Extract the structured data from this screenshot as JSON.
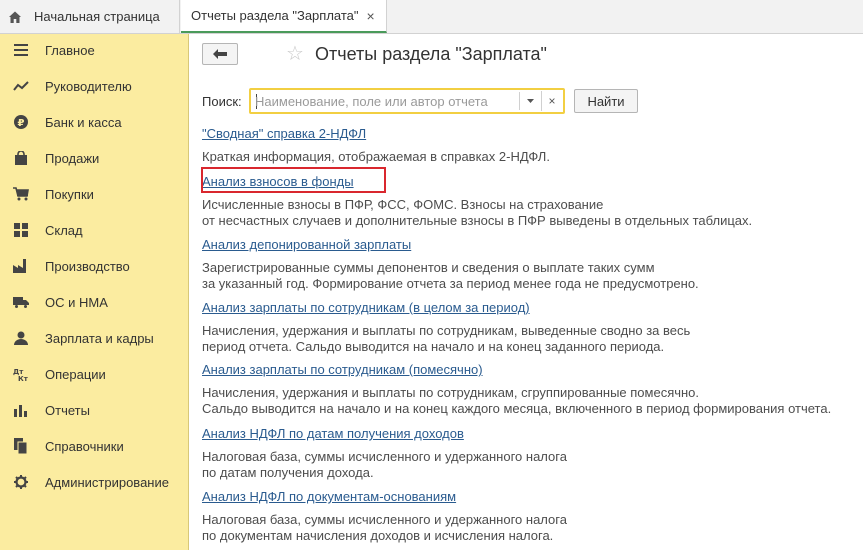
{
  "tabs": {
    "home_label": "Начальная страница",
    "active_label": "Отчеты раздела \"Зарплата\"",
    "close_glyph": "×"
  },
  "sidebar": {
    "background": "#fbeca0",
    "items": [
      {
        "label": "Главное",
        "icon": "menu-lines-icon"
      },
      {
        "label": "Руководителю",
        "icon": "trend-icon"
      },
      {
        "label": "Банк и касса",
        "icon": "ruble-icon"
      },
      {
        "label": "Продажи",
        "icon": "shopping-bag-icon"
      },
      {
        "label": "Покупки",
        "icon": "cart-icon"
      },
      {
        "label": "Склад",
        "icon": "grid-icon"
      },
      {
        "label": "Производство",
        "icon": "factory-icon"
      },
      {
        "label": "ОС и НМА",
        "icon": "truck-icon"
      },
      {
        "label": "Зарплата и кадры",
        "icon": "person-icon"
      },
      {
        "label": "Операции",
        "icon": "debit-credit-icon"
      },
      {
        "label": "Отчеты",
        "icon": "bar-chart-icon"
      },
      {
        "label": "Справочники",
        "icon": "books-icon"
      },
      {
        "label": "Администрирование",
        "icon": "gear-icon"
      }
    ]
  },
  "header": {
    "title": "Отчеты раздела \"Зарплата\""
  },
  "search": {
    "label": "Поиск:",
    "placeholder": "Наименование, поле или автор отчета",
    "button_label": "Найти"
  },
  "reports": [
    {
      "title": "\"Сводная\" справка 2-НДФЛ",
      "desc": [
        "Краткая информация, отображаемая в справках 2-НДФЛ."
      ]
    },
    {
      "title": "Анализ взносов в фонды",
      "desc": [
        "Исчисленные взносы в ПФР, ФСС, ФОМС. Взносы на страхование",
        "от несчастных случаев и дополнительные взносы в ПФР выведены в отдельных таблицах."
      ]
    },
    {
      "title": "Анализ депонированной зарплаты",
      "desc": [
        "Зарегистрированные суммы депонентов и сведения о выплате таких сумм",
        "за указанный год. Формирование отчета за период менее года не предусмотрено."
      ]
    },
    {
      "title": "Анализ зарплаты по сотрудникам (в целом за период)",
      "desc": [
        "Начисления, удержания и выплаты по сотрудникам, выведенные сводно за весь",
        "период отчета. Сальдо выводится на начало и на конец заданного периода."
      ]
    },
    {
      "title": "Анализ зарплаты по сотрудникам (помесячно)",
      "desc": [
        "Начисления, удержания и выплаты по сотрудникам, сгруппированные помесячно.",
        "Сальдо выводится на начало и на конец каждого месяца, включенного в период формирования отчета."
      ]
    },
    {
      "title": "Анализ НДФЛ по датам получения доходов",
      "desc": [
        "Налоговая база, суммы исчисленного и удержанного налога",
        "по датам получения дохода."
      ]
    },
    {
      "title": "Анализ НДФЛ по документам-основаниям",
      "desc": [
        "Налоговая база, суммы исчисленного и удержанного налога",
        "по документам начисления доходов и исчисления налога."
      ]
    }
  ],
  "colors": {
    "link": "#2a5b8f",
    "highlight_frame": "#d9272e",
    "search_border": "#f2cf42"
  }
}
